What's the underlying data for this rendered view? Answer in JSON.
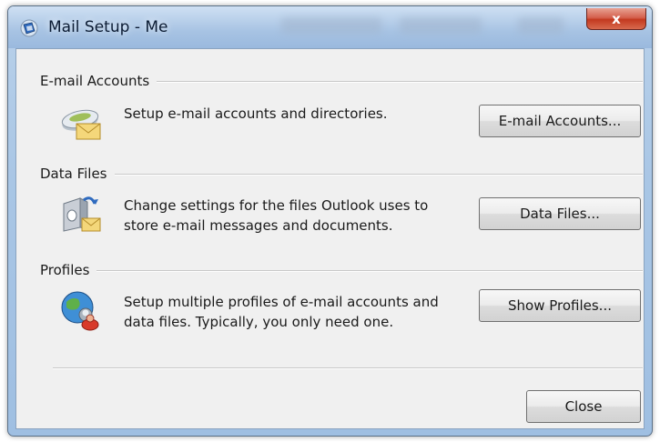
{
  "window": {
    "title": "Mail Setup - Me",
    "close_glyph": "x"
  },
  "groups": [
    {
      "title": "E-mail Accounts",
      "description": "Setup e-mail accounts and directories.",
      "button_label": "E-mail Accounts...",
      "icon": "email-accounts-icon"
    },
    {
      "title": "Data Files",
      "description_line1": "Change settings for the files Outlook uses to",
      "description_line2": "store e-mail messages and documents.",
      "button_label": "Data Files...",
      "icon": "data-files-icon"
    },
    {
      "title": "Profiles",
      "description_line1": "Setup multiple profiles of e-mail accounts and",
      "description_line2": "data files. Typically, you only need one.",
      "button_label": "Show Profiles...",
      "icon": "profiles-icon"
    }
  ],
  "footer": {
    "close_label": "Close"
  },
  "colors": {
    "title_bar": "#a7c3e3",
    "client_bg": "#f0f0f0",
    "close_button": "#c3391f"
  }
}
